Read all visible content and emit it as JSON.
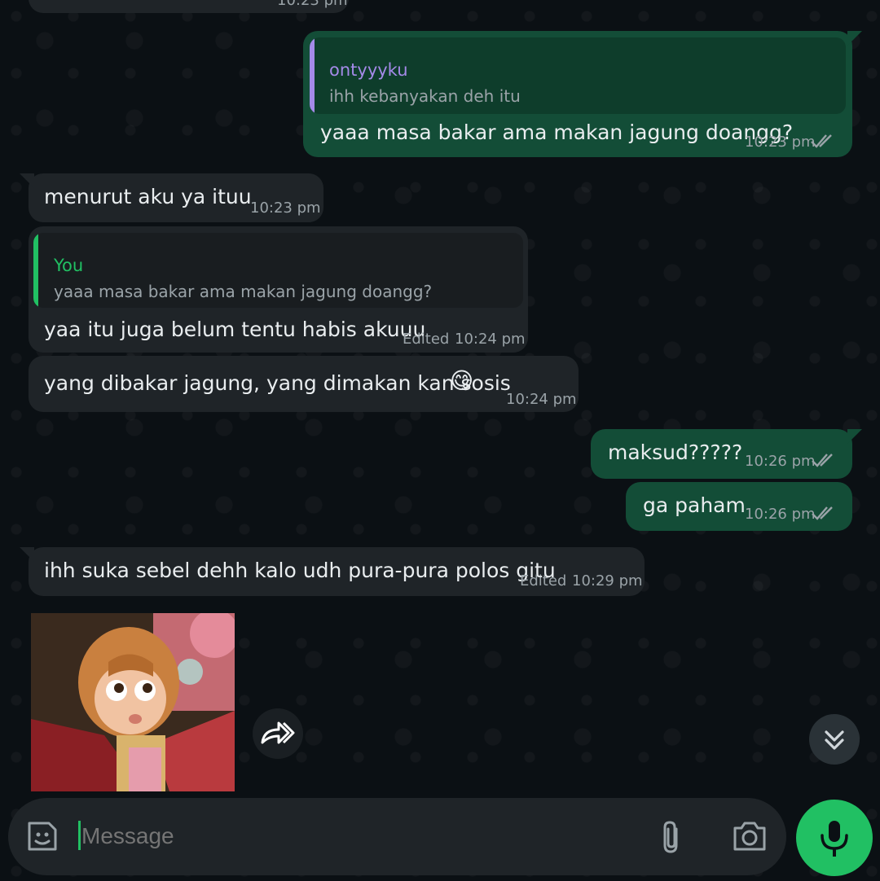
{
  "colors": {
    "background": "#0b1014",
    "incoming_bubble": "#1f2428",
    "outgoing_bubble": "#134d37",
    "accent_green": "#21c063",
    "quote_purple": "#a48ae8",
    "quote_green": "#21c063",
    "read_ticks": "#9aa3a8"
  },
  "top_partial": {
    "time": "10:23 pm"
  },
  "messages": [
    {
      "direction": "outgoing",
      "quote": {
        "author": "ontyyyku",
        "text": "ihh kebanyakan deh itu"
      },
      "text": "yaaa masa bakar ama makan jagung doangg?",
      "time": "10:23 pm",
      "status": "read"
    },
    {
      "direction": "incoming",
      "text": "menurut aku ya ituu",
      "time": "10:23 pm"
    },
    {
      "direction": "incoming",
      "quote": {
        "author": "You",
        "text": "yaaa masa bakar ama makan jagung doangg?"
      },
      "text": "yaa itu juga belum tentu habis akuuu",
      "edited": "Edited",
      "time": "10:24 pm"
    },
    {
      "direction": "incoming",
      "text": "yang dibakar jagung, yang dimakan kan sosis",
      "emoji": "😋",
      "time": "10:24 pm"
    },
    {
      "direction": "outgoing",
      "text": "maksud?????",
      "time": "10:26 pm",
      "status": "read"
    },
    {
      "direction": "outgoing",
      "text": "ga paham",
      "time": "10:26 pm",
      "status": "read"
    },
    {
      "direction": "incoming",
      "text": "ihh suka sebel dehh kalo udh pura-pura polos gitu",
      "edited": "Edited",
      "time": "10:29 pm"
    }
  ],
  "sticker": {
    "icon": "cartoon-girl-sticker"
  },
  "composer": {
    "placeholder": "Message",
    "icons": [
      "sticker-icon",
      "attach-icon",
      "camera-icon",
      "mic-icon"
    ]
  }
}
